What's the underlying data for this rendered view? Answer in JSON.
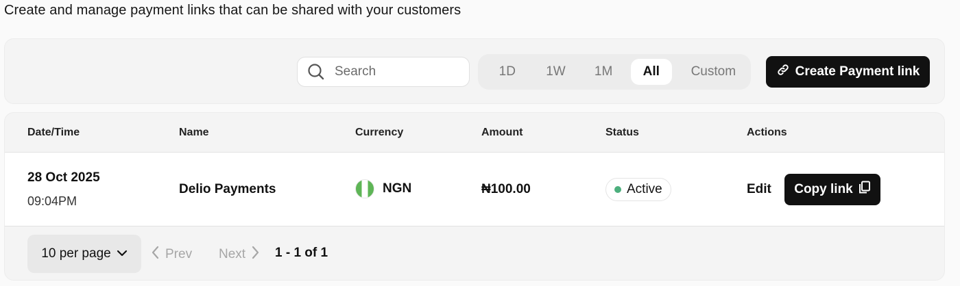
{
  "header": {
    "subtitle": "Create and manage payment links that can be shared with your customers"
  },
  "toolbar": {
    "search_placeholder": "Search",
    "ranges": [
      {
        "label": "1D",
        "active": false
      },
      {
        "label": "1W",
        "active": false
      },
      {
        "label": "1M",
        "active": false
      },
      {
        "label": "All",
        "active": true
      },
      {
        "label": "Custom",
        "active": false
      }
    ],
    "create_label": "Create Payment link"
  },
  "table": {
    "columns": [
      "Date/Time",
      "Name",
      "Currency",
      "Amount",
      "Status",
      "Actions"
    ],
    "rows": [
      {
        "date": "28 Oct 2025",
        "time": "09:04PM",
        "name": "Delio Payments",
        "currency": "NGN",
        "amount": "₦100.00",
        "status": "Active",
        "edit_label": "Edit",
        "copy_label": "Copy link"
      }
    ]
  },
  "pagination": {
    "per_page": "10 per page",
    "prev_label": "Prev",
    "next_label": "Next",
    "range_text": "1 - 1 of 1"
  },
  "colors": {
    "primary": "#111111",
    "status_active": "#4caf7d",
    "flag_green": "#5eb556"
  }
}
